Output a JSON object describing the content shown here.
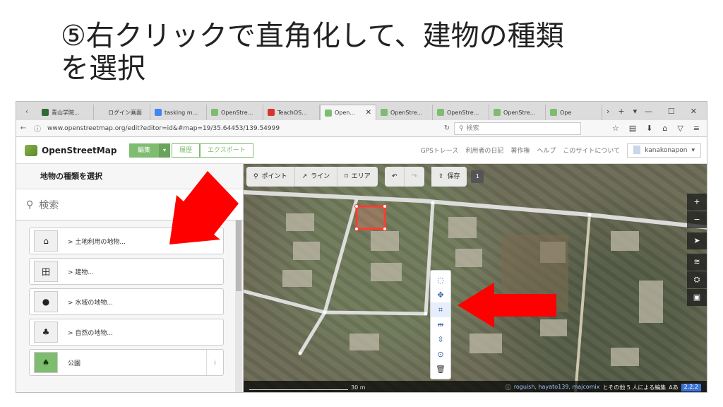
{
  "slide": {
    "title_line1": "⑤右クリックで直角化して、建物の種類",
    "title_line2": "を選択"
  },
  "browser": {
    "tabs": [
      {
        "label": "青山学院...",
        "fav": "#2f6b33"
      },
      {
        "label": "ログイン画面",
        "fav": "#dddddd"
      },
      {
        "label": "tasking m...",
        "fav": "#4285f4"
      },
      {
        "label": "OpenStre...",
        "fav": "#7ebc6f"
      },
      {
        "label": "TeachOS...",
        "fav": "#d9342b"
      },
      {
        "label": "Open...",
        "fav": "#7ebc6f",
        "active": true
      },
      {
        "label": "OpenStre...",
        "fav": "#7ebc6f"
      },
      {
        "label": "OpenStre...",
        "fav": "#7ebc6f"
      },
      {
        "label": "OpenStre...",
        "fav": "#7ebc6f"
      },
      {
        "label": "Ope",
        "fav": "#7ebc6f"
      }
    ],
    "tab_close": "✕",
    "new_tab": "+",
    "url": "www.openstreetmap.org/edit?editor=id&#map=19/35.64453/139.54999",
    "search_placeholder": "検索"
  },
  "osm": {
    "logo": "OpenStreetMap",
    "edit_label": "編集",
    "history_label": "履歴",
    "export_label": "エクスポート",
    "nav": [
      "GPSトレース",
      "利用者の日記",
      "著作権",
      "ヘルプ",
      "このサイトについて"
    ],
    "user": "kanakonapon"
  },
  "sidebar": {
    "title": "地物の種類を選択",
    "search_placeholder": "検索",
    "presets": [
      {
        "icon": "landuse-icon",
        "glyph": "⌂",
        "label": "> 土地利用の地物..."
      },
      {
        "icon": "building-icon",
        "glyph": "田",
        "label": "> 建物..."
      },
      {
        "icon": "water-icon",
        "glyph": "●",
        "label": "> 水域の地物..."
      },
      {
        "icon": "natural-icon",
        "glyph": "♣",
        "label": "> 自然の地物..."
      },
      {
        "icon": "park-icon",
        "glyph": "♠",
        "label": "公園",
        "info": "i"
      }
    ]
  },
  "map": {
    "toolbar": {
      "point": "ポイント",
      "line": "ライン",
      "area": "エリア",
      "save": "保存",
      "count": "1"
    },
    "scale_label": "30 m",
    "attribution_users": "roguish, hayato139, majcomix",
    "attribution_rest": "とその他 5 人による編集",
    "lang": "Aあ",
    "version": "2.2.2"
  }
}
